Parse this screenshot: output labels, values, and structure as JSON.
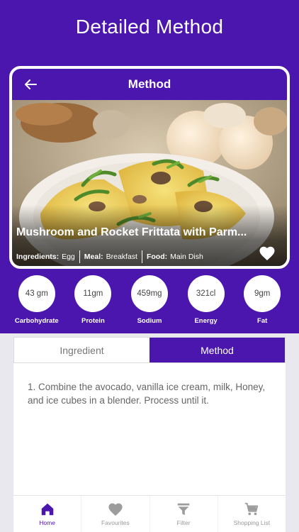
{
  "page_title": "Detailed Method",
  "appbar": {
    "title": "Method"
  },
  "recipe": {
    "title": "Mushroom and Rocket Frittata with Parm...",
    "meta": [
      {
        "key": "Ingredients:",
        "value": "Egg"
      },
      {
        "key": "Meal:",
        "value": "Breakfast"
      },
      {
        "key": "Food:",
        "value": "Main Dish"
      }
    ]
  },
  "nutrients": [
    {
      "value": "43 gm",
      "label": "Carbohydrate"
    },
    {
      "value": "11gm",
      "label": "Protein"
    },
    {
      "value": "459mg",
      "label": "Sodium"
    },
    {
      "value": "321cl",
      "label": "Energy"
    },
    {
      "value": "9gm",
      "label": "Fat"
    }
  ],
  "tabs": {
    "ingredient": "Ingredient",
    "method": "Method",
    "active": "method"
  },
  "method_text": "1. Combine the avocado, vanilla ice cream, milk, Honey, and ice cubes in a blender. Process until it.",
  "bottom_nav": [
    {
      "label": "Home",
      "icon": "home-icon",
      "active": true
    },
    {
      "label": "Favourites",
      "icon": "heart-icon",
      "active": false
    },
    {
      "label": "Filter",
      "icon": "filter-icon",
      "active": false
    },
    {
      "label": "Shopping List",
      "icon": "cart-icon",
      "active": false
    }
  ],
  "colors": {
    "brand": "#4a16ad",
    "inactive_icon": "#9c9c9c"
  }
}
